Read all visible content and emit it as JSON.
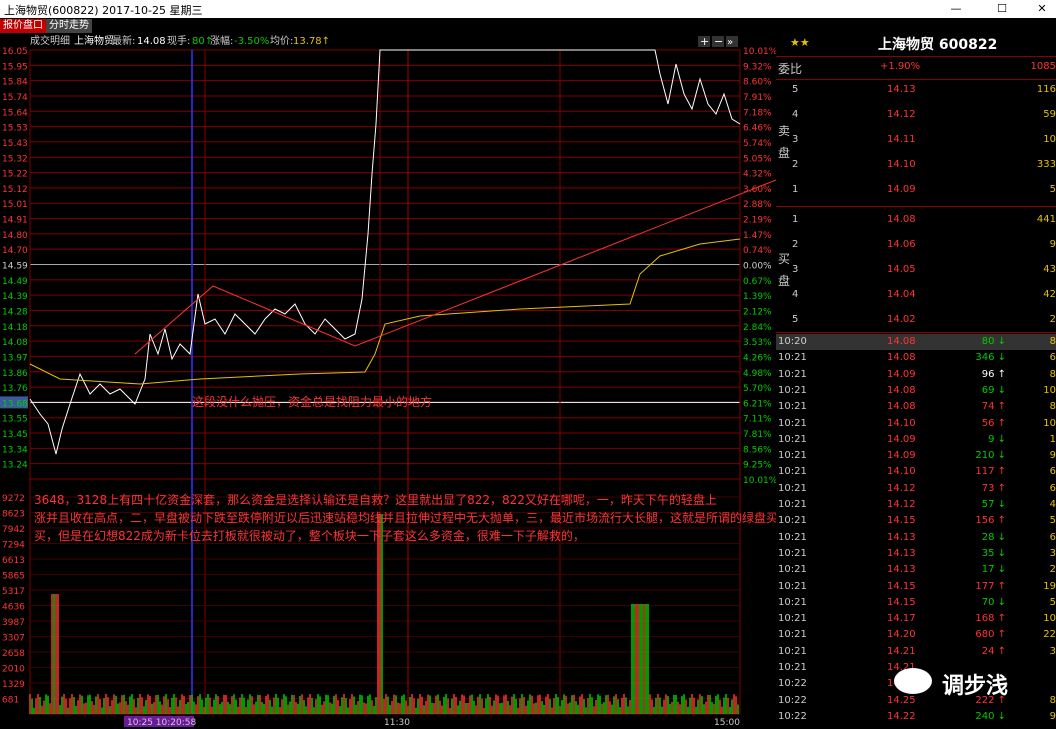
{
  "window": {
    "title": "上海物贸(600822) 2017-10-25 星期三",
    "min": "—",
    "max": "☐",
    "close": "✕"
  },
  "tabs": [
    "报价盘口",
    "分时走势"
  ],
  "header": {
    "label1": "成交明细",
    "stock": "上海物贸",
    "latest_label": "最新:",
    "latest": "14.08",
    "vol_label": "现手:",
    "vol": "80↑",
    "chg_label": "涨幅:",
    "chg": "-3.50%",
    "avg_label": "均价:",
    "avg": "13.78↑"
  },
  "tools": [
    "+",
    "−",
    "»"
  ],
  "axis": {
    "prices": [
      "16.05",
      "15.95",
      "15.84",
      "15.74",
      "15.64",
      "15.53",
      "15.43",
      "15.32",
      "15.22",
      "15.12",
      "15.01",
      "14.91",
      "14.80",
      "14.70",
      "14.59",
      "14.49",
      "14.39",
      "14.28",
      "14.18",
      "14.08",
      "13.97",
      "13.86",
      "13.76",
      "13.68",
      "13.55",
      "13.45",
      "13.34",
      "13.24"
    ],
    "pcts": [
      "10.01%",
      "9.32%",
      "8.60%",
      "7.91%",
      "7.18%",
      "6.46%",
      "5.74%",
      "5.05%",
      "4.32%",
      "3.60%",
      "2.88%",
      "2.19%",
      "1.47%",
      "0.74%",
      "0.00%",
      "0.67%",
      "1.39%",
      "2.12%",
      "2.84%",
      "3.53%",
      "4.26%",
      "4.98%",
      "5.70%",
      "6.21%",
      "7.11%",
      "7.81%",
      "8.56%",
      "9.25%",
      "10.01%"
    ],
    "vols": [
      "9272",
      "8623",
      "7942",
      "7294",
      "6613",
      "5865",
      "5317",
      "4636",
      "3987",
      "3307",
      "2658",
      "2010",
      "1329",
      "681"
    ],
    "times": [
      "10:25 10:20:58",
      "11:30",
      "15:00"
    ]
  },
  "annotations": {
    "note1": "这段没什么抛压，资金总是找阻力最小的地方",
    "note2": "3648，3128上有四十亿资金深套，那么资金是选择认输还是自救？这里就出显了822，822又好在哪呢，一，昨天下午的轻盘上涨并且收在高点，二，早盘被动下跌至跌停附近以后迅速站稳均线并且拉伸过程中无大抛单，三，最近市场流行大长腿，这就是所谓的绿盘买买，但是在幻想822成为新卡位去打板就很被动了，整个板块一下子套这么多资金，很难一下子解救的，"
  },
  "side": {
    "stars": "★★",
    "title": "上海物贸 600822",
    "webi": {
      "label": "委比",
      "pct": "+1.90%",
      "vol": "1085"
    },
    "sell_label": "卖盘",
    "buy_label": "买盘",
    "sells": [
      {
        "lv": "5",
        "p": "14.13",
        "v": "116"
      },
      {
        "lv": "4",
        "p": "14.12",
        "v": "59"
      },
      {
        "lv": "3",
        "p": "14.11",
        "v": "10"
      },
      {
        "lv": "2",
        "p": "14.10",
        "v": "333"
      },
      {
        "lv": "1",
        "p": "14.09",
        "v": "5"
      }
    ],
    "buys": [
      {
        "lv": "1",
        "p": "14.08",
        "v": "441"
      },
      {
        "lv": "2",
        "p": "14.06",
        "v": "9"
      },
      {
        "lv": "3",
        "p": "14.05",
        "v": "43"
      },
      {
        "lv": "4",
        "p": "14.04",
        "v": "42"
      },
      {
        "lv": "5",
        "p": "14.02",
        "v": "2"
      }
    ],
    "trades": [
      {
        "t": "10:20",
        "p": "14.08",
        "v": "80",
        "d": "dn",
        "s": "8",
        "hl": true
      },
      {
        "t": "10:21",
        "p": "14.08",
        "v": "346",
        "d": "dn",
        "s": "6"
      },
      {
        "t": "10:21",
        "p": "14.09",
        "v": "96",
        "d": "wt",
        "s": "8"
      },
      {
        "t": "10:21",
        "p": "14.08",
        "v": "69",
        "d": "dn",
        "s": "10"
      },
      {
        "t": "10:21",
        "p": "14.08",
        "v": "74",
        "d": "up",
        "s": "8"
      },
      {
        "t": "10:21",
        "p": "14.10",
        "v": "56",
        "d": "up",
        "s": "10"
      },
      {
        "t": "10:21",
        "p": "14.09",
        "v": "9",
        "d": "dn",
        "s": "1"
      },
      {
        "t": "10:21",
        "p": "14.09",
        "v": "210",
        "d": "dn",
        "s": "9"
      },
      {
        "t": "10:21",
        "p": "14.10",
        "v": "117",
        "d": "up",
        "s": "6"
      },
      {
        "t": "10:21",
        "p": "14.12",
        "v": "73",
        "d": "up",
        "s": "6"
      },
      {
        "t": "10:21",
        "p": "14.12",
        "v": "57",
        "d": "dn",
        "s": "4"
      },
      {
        "t": "10:21",
        "p": "14.15",
        "v": "156",
        "d": "up",
        "s": "5"
      },
      {
        "t": "10:21",
        "p": "14.13",
        "v": "28",
        "d": "dn",
        "s": "6"
      },
      {
        "t": "10:21",
        "p": "14.13",
        "v": "35",
        "d": "dn",
        "s": "3"
      },
      {
        "t": "10:21",
        "p": "14.13",
        "v": "17",
        "d": "dn",
        "s": "2"
      },
      {
        "t": "10:21",
        "p": "14.15",
        "v": "177",
        "d": "up",
        "s": "19"
      },
      {
        "t": "10:21",
        "p": "14.15",
        "v": "70",
        "d": "dn",
        "s": "5"
      },
      {
        "t": "10:21",
        "p": "14.17",
        "v": "168",
        "d": "up",
        "s": "10"
      },
      {
        "t": "10:21",
        "p": "14.20",
        "v": "680",
        "d": "up",
        "s": "22"
      },
      {
        "t": "10:21",
        "p": "14.21",
        "v": "24",
        "d": "up",
        "s": "3"
      },
      {
        "t": "10:21",
        "p": "14.21",
        "v": "",
        "d": "up",
        "s": ""
      },
      {
        "t": "10:22",
        "p": "14.25",
        "v": "",
        "d": "up",
        "s": ""
      },
      {
        "t": "10:22",
        "p": "14.25",
        "v": "222",
        "d": "up",
        "s": "8"
      },
      {
        "t": "10:22",
        "p": "14.22",
        "v": "240",
        "d": "dn",
        "s": "9"
      }
    ]
  },
  "watermark": "调步浅",
  "colors": {
    "up": "#ff3333",
    "down": "#00cc00",
    "price_line": "#ffffff",
    "avg_line": "#e6c000",
    "grid": "#800000",
    "cursor": "#3333ff"
  }
}
